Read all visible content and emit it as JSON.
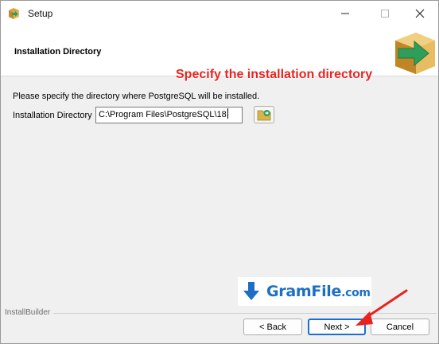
{
  "window": {
    "title": "Setup",
    "icon": "installer-box-icon",
    "controls": {
      "minimize": "minimize-icon",
      "maximize": "maximize-icon",
      "close": "close-icon"
    }
  },
  "header": {
    "title": "Installation Directory",
    "logo": "installer-box-arrow-icon"
  },
  "annotation": {
    "text": "Specify the installation directory",
    "color": "#e8231f"
  },
  "body": {
    "description": "Please specify the directory where PostgreSQL will be installed.",
    "directory_label": "Installation Directory",
    "directory_value": "C:\\Program Files\\PostgreSQL\\18",
    "browse_icon": "folder-browse-icon"
  },
  "watermark": {
    "text": "GramFile",
    "suffix": ".com",
    "color": "#1d6fc4"
  },
  "footer": {
    "brand": "InstallBuilder",
    "back_label": "< Back",
    "next_label": "Next >",
    "cancel_label": "Cancel"
  },
  "colors": {
    "focus_border": "#1a6fd1",
    "arrow": "#e8231f"
  }
}
